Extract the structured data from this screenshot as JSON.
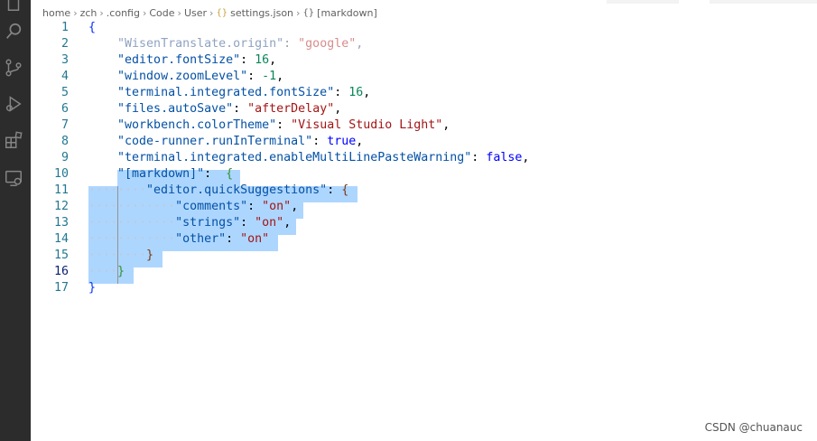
{
  "activity_bar": {
    "icons": [
      "files-icon",
      "search-icon",
      "source-control-icon",
      "run-debug-icon",
      "extensions-icon",
      "remote-explorer-icon"
    ]
  },
  "breadcrumb": {
    "items": [
      "home",
      "zch",
      ".config",
      "Code",
      "User",
      "settings.json",
      "[markdown]"
    ],
    "json_glyph": "{}",
    "obj_glyph": "{}"
  },
  "editor": {
    "line_numbers": [
      "1",
      "2",
      "3",
      "4",
      "5",
      "6",
      "7",
      "8",
      "9",
      "10",
      "11",
      "12",
      "13",
      "14",
      "15",
      "16",
      "17"
    ],
    "active_line": "16",
    "lines": [
      [
        {
          "t": "{",
          "c": "brace"
        }
      ],
      [
        {
          "t": "    ",
          "c": "ws"
        },
        {
          "t": "\"WisenTranslate.origin\"",
          "c": "key-faded"
        },
        {
          "t": ": ",
          "c": "punct-faded"
        },
        {
          "t": "\"google\"",
          "c": "str-faded"
        },
        {
          "t": ",",
          "c": "punct-faded"
        }
      ],
      [
        {
          "t": "    ",
          "c": "ws"
        },
        {
          "t": "\"editor.fontSize\"",
          "c": "key"
        },
        {
          "t": ": ",
          "c": "punct"
        },
        {
          "t": "16",
          "c": "num"
        },
        {
          "t": ",",
          "c": "punct"
        }
      ],
      [
        {
          "t": "    ",
          "c": "ws"
        },
        {
          "t": "\"window.zoomLevel\"",
          "c": "key"
        },
        {
          "t": ": ",
          "c": "punct"
        },
        {
          "t": "-1",
          "c": "num"
        },
        {
          "t": ",",
          "c": "punct"
        }
      ],
      [
        {
          "t": "    ",
          "c": "ws"
        },
        {
          "t": "\"terminal.integrated.fontSize\"",
          "c": "key"
        },
        {
          "t": ": ",
          "c": "punct"
        },
        {
          "t": "16",
          "c": "num"
        },
        {
          "t": ",",
          "c": "punct"
        }
      ],
      [
        {
          "t": "    ",
          "c": "ws"
        },
        {
          "t": "\"files.autoSave\"",
          "c": "key"
        },
        {
          "t": ": ",
          "c": "punct"
        },
        {
          "t": "\"afterDelay\"",
          "c": "str"
        },
        {
          "t": ",",
          "c": "punct"
        }
      ],
      [
        {
          "t": "    ",
          "c": "ws"
        },
        {
          "t": "\"workbench.colorTheme\"",
          "c": "key"
        },
        {
          "t": ": ",
          "c": "punct"
        },
        {
          "t": "\"Visual Studio Light\"",
          "c": "str"
        },
        {
          "t": ",",
          "c": "punct"
        }
      ],
      [
        {
          "t": "    ",
          "c": "ws"
        },
        {
          "t": "\"code-runner.runInTerminal\"",
          "c": "key"
        },
        {
          "t": ": ",
          "c": "punct"
        },
        {
          "t": "true",
          "c": "bool"
        },
        {
          "t": ",",
          "c": "punct"
        }
      ],
      [
        {
          "t": "    ",
          "c": "ws"
        },
        {
          "t": "\"terminal.integrated.enableMultiLinePasteWarning\"",
          "c": "key"
        },
        {
          "t": ": ",
          "c": "punct"
        },
        {
          "t": "false",
          "c": "bool"
        },
        {
          "t": ",",
          "c": "punct"
        }
      ],
      [
        {
          "t": "    ",
          "c": "ws"
        },
        {
          "t": "\"[markdown]\"",
          "c": "key"
        },
        {
          "t": ":  ",
          "c": "punct"
        },
        {
          "t": "{",
          "c": "brace2"
        }
      ],
      [
        {
          "t": "········",
          "c": "ws"
        },
        {
          "t": "\"editor.quickSuggestions\"",
          "c": "key"
        },
        {
          "t": ": ",
          "c": "punct"
        },
        {
          "t": "{",
          "c": "brace3"
        }
      ],
      [
        {
          "t": "············",
          "c": "ws"
        },
        {
          "t": "\"comments\"",
          "c": "key"
        },
        {
          "t": ": ",
          "c": "punct"
        },
        {
          "t": "\"on\"",
          "c": "str"
        },
        {
          "t": ",",
          "c": "punct"
        }
      ],
      [
        {
          "t": "············",
          "c": "ws"
        },
        {
          "t": "\"strings\"",
          "c": "key"
        },
        {
          "t": ": ",
          "c": "punct"
        },
        {
          "t": "\"on\"",
          "c": "str"
        },
        {
          "t": ",",
          "c": "punct"
        }
      ],
      [
        {
          "t": "············",
          "c": "ws"
        },
        {
          "t": "\"other\"",
          "c": "key"
        },
        {
          "t": ": ",
          "c": "punct"
        },
        {
          "t": "\"on\"",
          "c": "str"
        }
      ],
      [
        {
          "t": "········",
          "c": "ws"
        },
        {
          "t": "}",
          "c": "brace3"
        }
      ],
      [
        {
          "t": "····",
          "c": "ws"
        },
        {
          "t": "}",
          "c": "brace2"
        }
      ],
      [
        {
          "t": "}",
          "c": "brace"
        }
      ]
    ]
  },
  "watermark": "CSDN @chuanauc",
  "colors": {
    "activity_bar": "#2c2c2c",
    "selection": "#add6ff",
    "line_number": "#237893",
    "active_line_number": "#0b216f"
  }
}
